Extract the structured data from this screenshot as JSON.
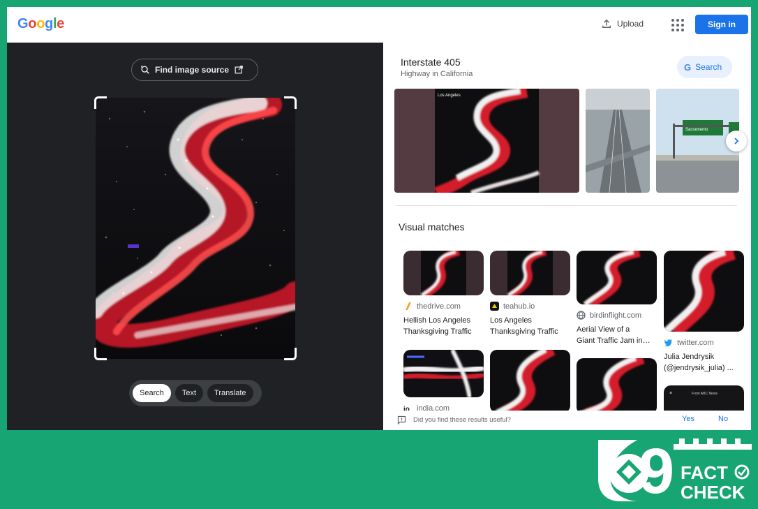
{
  "header": {
    "logo": "Google",
    "logo_colors": [
      "#4285f4",
      "#ea4335",
      "#fbbc05",
      "#4285f4",
      "#34a853",
      "#ea4335"
    ],
    "upload_label": "Upload",
    "upload_icon": "upload-icon",
    "apps_icon": "apps-grid-icon",
    "signin_label": "Sign in"
  },
  "lens": {
    "find_source_label": "Find image source",
    "modes": [
      {
        "label": "Search",
        "active": true
      },
      {
        "label": "Text",
        "active": false
      },
      {
        "label": "Translate",
        "active": false
      }
    ]
  },
  "knowledge_panel": {
    "title": "Interstate 405",
    "subtitle": "Highway in California",
    "search_label": "Search",
    "first_image_caption": "Los Angeles",
    "sign_text": "Sacramento"
  },
  "visual_matches": {
    "title": "Visual matches",
    "items": [
      {
        "source": "thedrive.com",
        "title": "Hellish Los Angeles Thanksgiving Traffic",
        "icon": "thedrive-icon"
      },
      {
        "source": "teahub.io",
        "title": "Los Angeles Thanksgiving Traffic",
        "icon": "teahub-icon"
      },
      {
        "source": "birdinflight.com",
        "title_line1": "Aerial View of a",
        "title_line2": "Giant Traffic Jam in",
        "icon": "globe-icon"
      },
      {
        "source": "twitter.com",
        "title_line1": "Julia Jendrysik",
        "title_line2": "(@jendrysik_julia) ...",
        "icon": "twitter-icon"
      },
      {
        "source": "india.com",
        "icon": "india-icon"
      },
      {
        "overlay_text": "From ABC News"
      }
    ]
  },
  "feedback": {
    "question": "Did you find these results useful?",
    "yes": "Yes",
    "no": "No"
  },
  "badge": {
    "number": "9",
    "line1": "FACT",
    "line2": "CHECK",
    "color": "#17a673"
  }
}
